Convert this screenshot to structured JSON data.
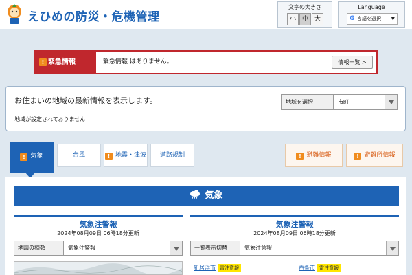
{
  "header": {
    "site_title": "えひめの防災・危機管理",
    "font_size": {
      "title": "文字の大きさ",
      "small": "小",
      "medium": "中",
      "large": "大",
      "active": "中"
    },
    "language": {
      "title": "Language",
      "select_label": "言語を選択",
      "arrow": "▼"
    }
  },
  "emergency": {
    "label": "緊急情報",
    "message": "緊急情報 はありません。",
    "list_button": "情報一覧 >"
  },
  "region": {
    "message": "お住まいの地域の最新情報を表示します。",
    "select_label": "地域を選択",
    "select_value": "市町",
    "status": "地域が設定されておりません"
  },
  "tabs": [
    {
      "label": "気象",
      "alert": true,
      "active": true
    },
    {
      "label": "台風",
      "alert": false,
      "active": false
    },
    {
      "label": "地震・津波",
      "alert": true,
      "active": false
    },
    {
      "label": "道路規制",
      "alert": false,
      "active": false
    },
    {
      "label": "避難情報",
      "alert": true,
      "active": false
    },
    {
      "label": "避難所情報",
      "alert": true,
      "active": false
    }
  ],
  "alert_mark": "!",
  "weather": {
    "banner_title": "気象",
    "left": {
      "title": "気象注警報",
      "updated": "2024年08月09日 06時18分更新",
      "select_label": "地図の種類",
      "select_value": "気象注警報"
    },
    "right": {
      "title": "気象注警報",
      "updated": "2024年08月09日 06時18分更新",
      "select_label": "一覧表示切替",
      "select_value": "気象注意報",
      "items": [
        {
          "city": "新居浜市",
          "badge": "雷注意報"
        },
        {
          "city": "西条市",
          "badge": "雷注意報"
        }
      ]
    }
  },
  "colors": {
    "brand_blue": "#1e63b5",
    "emergency_red": "#c0272d",
    "alert_orange": "#f08c1e",
    "badge_yellow": "#ffe600"
  }
}
